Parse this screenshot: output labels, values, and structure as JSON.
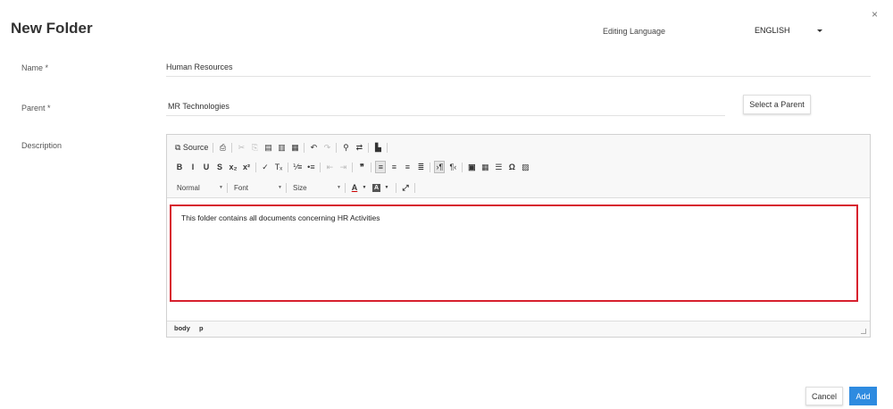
{
  "dialog": {
    "title": "New Folder",
    "close_glyph": "×",
    "language_label": "Editing Language",
    "language_value": "ENGLISH"
  },
  "fields": {
    "name_label": "Name *",
    "name_value": "Human Resources",
    "parent_label": "Parent  *",
    "parent_value": "MR Technologies",
    "select_parent_label": "Select a Parent",
    "description_label": "Description"
  },
  "editor": {
    "row1": [
      {
        "name": "source-button",
        "glyph": "⧉ Source",
        "state": "normal"
      },
      {
        "name": "sep"
      },
      {
        "name": "print-icon",
        "glyph": "⎙",
        "state": "normal"
      },
      {
        "name": "sep"
      },
      {
        "name": "cut-icon",
        "glyph": "✂",
        "state": "dim"
      },
      {
        "name": "copy-icon",
        "glyph": "⎘",
        "state": "dim"
      },
      {
        "name": "paste-icon",
        "glyph": "▤",
        "state": "normal"
      },
      {
        "name": "paste-text-icon",
        "glyph": "▥",
        "state": "normal"
      },
      {
        "name": "paste-word-icon",
        "glyph": "▦",
        "state": "normal"
      },
      {
        "name": "sep"
      },
      {
        "name": "undo-icon",
        "glyph": "↶",
        "state": "normal"
      },
      {
        "name": "redo-icon",
        "glyph": "↷",
        "state": "dim"
      },
      {
        "name": "sep"
      },
      {
        "name": "find-icon",
        "glyph": "⚲",
        "state": "normal"
      },
      {
        "name": "replace-icon",
        "glyph": "⇄",
        "state": "normal"
      },
      {
        "name": "sep"
      },
      {
        "name": "spellcheck-icon",
        "glyph": "▙",
        "state": "normal"
      },
      {
        "name": "sep"
      }
    ],
    "row2": [
      {
        "name": "bold-icon",
        "glyph": "B",
        "state": "bold"
      },
      {
        "name": "italic-icon",
        "glyph": "I",
        "state": "bold"
      },
      {
        "name": "underline-icon",
        "glyph": "U",
        "state": "bold"
      },
      {
        "name": "strikethrough-icon",
        "glyph": "S",
        "state": "bold"
      },
      {
        "name": "subscript-icon",
        "glyph": "x₂",
        "state": "bold"
      },
      {
        "name": "superscript-icon",
        "glyph": "x²",
        "state": "bold"
      },
      {
        "name": "sep"
      },
      {
        "name": "copy-format-icon",
        "glyph": "✓",
        "state": "normal"
      },
      {
        "name": "remove-format-icon",
        "glyph": "Tₓ",
        "state": "normal"
      },
      {
        "name": "sep"
      },
      {
        "name": "numbered-list-icon",
        "glyph": "⅟≡",
        "state": "normal"
      },
      {
        "name": "bulleted-list-icon",
        "glyph": "•≡",
        "state": "normal"
      },
      {
        "name": "sep"
      },
      {
        "name": "outdent-icon",
        "glyph": "⇤",
        "state": "dim"
      },
      {
        "name": "indent-icon",
        "glyph": "⇥",
        "state": "dim"
      },
      {
        "name": "sep"
      },
      {
        "name": "blockquote-icon",
        "glyph": "❞",
        "state": "bold"
      },
      {
        "name": "sep"
      },
      {
        "name": "align-left-icon",
        "glyph": "≡",
        "state": "active"
      },
      {
        "name": "align-center-icon",
        "glyph": "≡",
        "state": "normal"
      },
      {
        "name": "align-right-icon",
        "glyph": "≡",
        "state": "normal"
      },
      {
        "name": "justify-icon",
        "glyph": "≣",
        "state": "normal"
      },
      {
        "name": "sep"
      },
      {
        "name": "ltr-icon",
        "glyph": "›¶",
        "state": "active"
      },
      {
        "name": "rtl-icon",
        "glyph": "¶‹",
        "state": "normal"
      },
      {
        "name": "sep"
      },
      {
        "name": "youtube-icon",
        "glyph": "▣",
        "state": "bold"
      },
      {
        "name": "table-icon",
        "glyph": "▦",
        "state": "normal"
      },
      {
        "name": "horizontal-line-icon",
        "glyph": "☰",
        "state": "normal"
      },
      {
        "name": "special-char-icon",
        "glyph": "Ω",
        "state": "bold"
      },
      {
        "name": "image-icon",
        "glyph": "▨",
        "state": "normal"
      }
    ],
    "row3": {
      "format_label": "Normal",
      "font_label": "Font",
      "size_label": "Size",
      "dropdown_glyph": "▼",
      "text_color_glyph": "A",
      "bg_color_glyph": "A",
      "maximize_glyph": "⤢"
    },
    "content": "This folder contains all documents concerning HR Activities",
    "path": [
      "body",
      "p"
    ]
  },
  "footer": {
    "cancel_label": "Cancel",
    "add_label": "Add"
  },
  "colors": {
    "primary_button": "#2e8be0",
    "highlight_border": "#d7202e"
  }
}
